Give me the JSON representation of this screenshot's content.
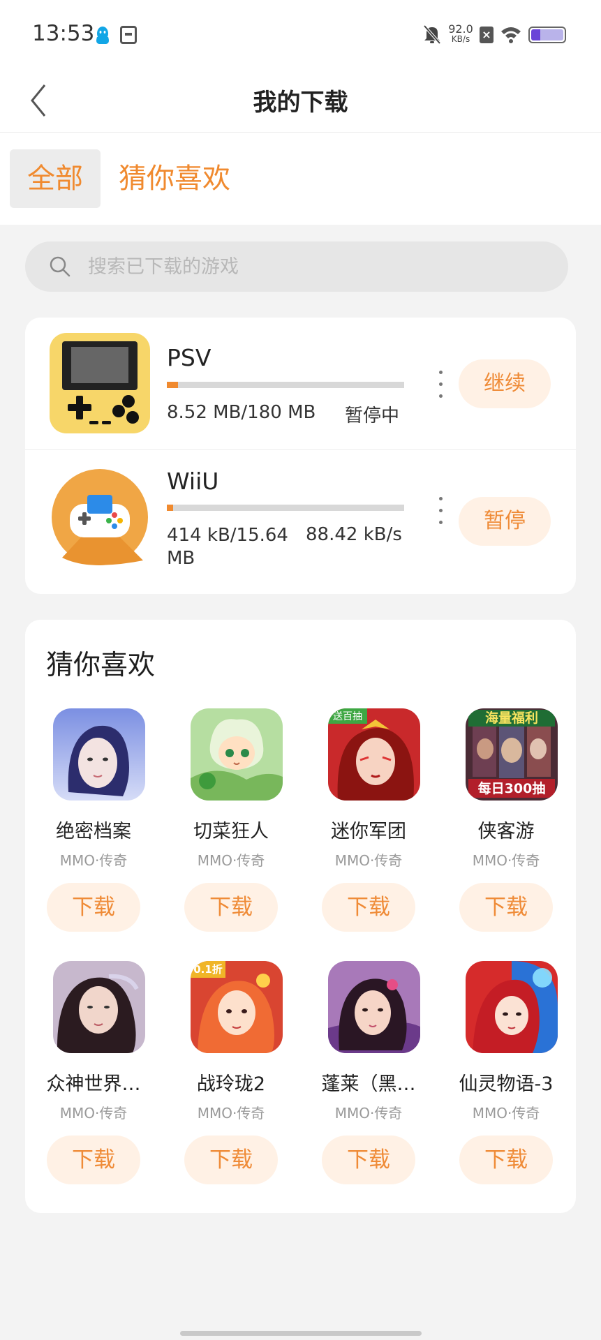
{
  "status": {
    "time": "13:53",
    "speed_value": "92.0",
    "speed_unit": "KB/s",
    "x_icon": "x-icon",
    "battery_fill": 0.28
  },
  "header": {
    "title": "我的下载"
  },
  "tabs": [
    {
      "label": "全部",
      "active": true
    },
    {
      "label": "猜你喜欢",
      "active": false
    }
  ],
  "search": {
    "placeholder": "搜索已下载的游戏"
  },
  "downloads": [
    {
      "name": "PSV",
      "progress": 0.047,
      "size": "8.52 MB/180 MB",
      "status": "暂停中",
      "action": "继续",
      "icon": "handheld-console-icon"
    },
    {
      "name": "WiiU",
      "progress": 0.026,
      "size": "414 kB/15.64 MB",
      "status": "88.42 kB/s",
      "action": "暂停",
      "icon": "gamepad-icon"
    }
  ],
  "recommend": {
    "title": "猜你喜欢",
    "games": [
      {
        "name": "绝密档案",
        "category": "MMO·传奇",
        "button": "下载"
      },
      {
        "name": "切菜狂人",
        "category": "MMO·传奇",
        "button": "下载"
      },
      {
        "name": "迷你军团",
        "category": "MMO·传奇",
        "button": "下载",
        "badge": "送百抽"
      },
      {
        "name": "侠客游",
        "category": "MMO·传奇",
        "button": "下载",
        "badge_top": "海量福利",
        "badge_bottom": "每日300抽"
      },
      {
        "name": "众神世界…",
        "category": "MMO·传奇",
        "button": "下载"
      },
      {
        "name": "战玲珑2",
        "category": "MMO·传奇",
        "button": "下载",
        "badge": "0.1折"
      },
      {
        "name": "蓬莱（黑…",
        "category": "MMO·传奇",
        "button": "下载"
      },
      {
        "name": "仙灵物语-3",
        "category": "MMO·传奇",
        "button": "下载"
      }
    ]
  },
  "colors": {
    "accent": "#f08a2f",
    "button_bg": "#fff1e5",
    "background": "#f3f3f3"
  }
}
